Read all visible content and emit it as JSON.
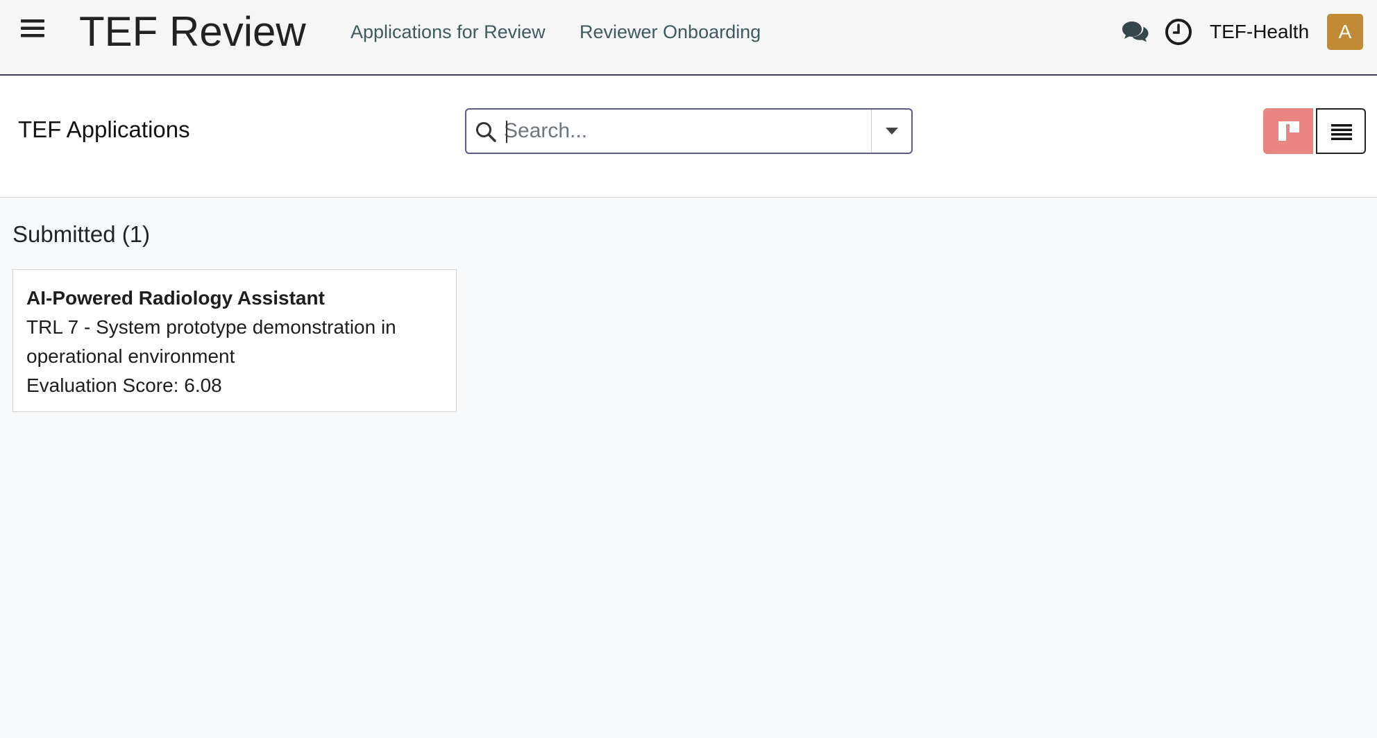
{
  "navbar": {
    "brand": "TEF Review",
    "links": [
      "Applications for Review",
      "Reviewer Onboarding"
    ],
    "company": "TEF-Health",
    "avatar_initial": "A",
    "icons": [
      "menu-icon",
      "chat-icon",
      "clock-icon"
    ]
  },
  "control_panel": {
    "title": "TEF Applications",
    "search": {
      "placeholder": "Search...",
      "value": ""
    },
    "views": [
      "kanban",
      "list"
    ],
    "active_view": "kanban"
  },
  "kanban": {
    "columns": [
      {
        "title": "Submitted (1)",
        "cards": [
          {
            "name": "AI-Powered Radiology Assistant",
            "trl": "TRL 7 - System prototype demonstration in operational environment",
            "score": "Evaluation Score: 6.08"
          }
        ]
      }
    ]
  },
  "colors": {
    "navbar_bg": "#f5f6f5",
    "navbar_border": "#3e3e5a",
    "avatar": "#c08a36",
    "kanban_active": "#e98583",
    "search_border": "#5b5a8c",
    "link": "#3f5a5f"
  }
}
